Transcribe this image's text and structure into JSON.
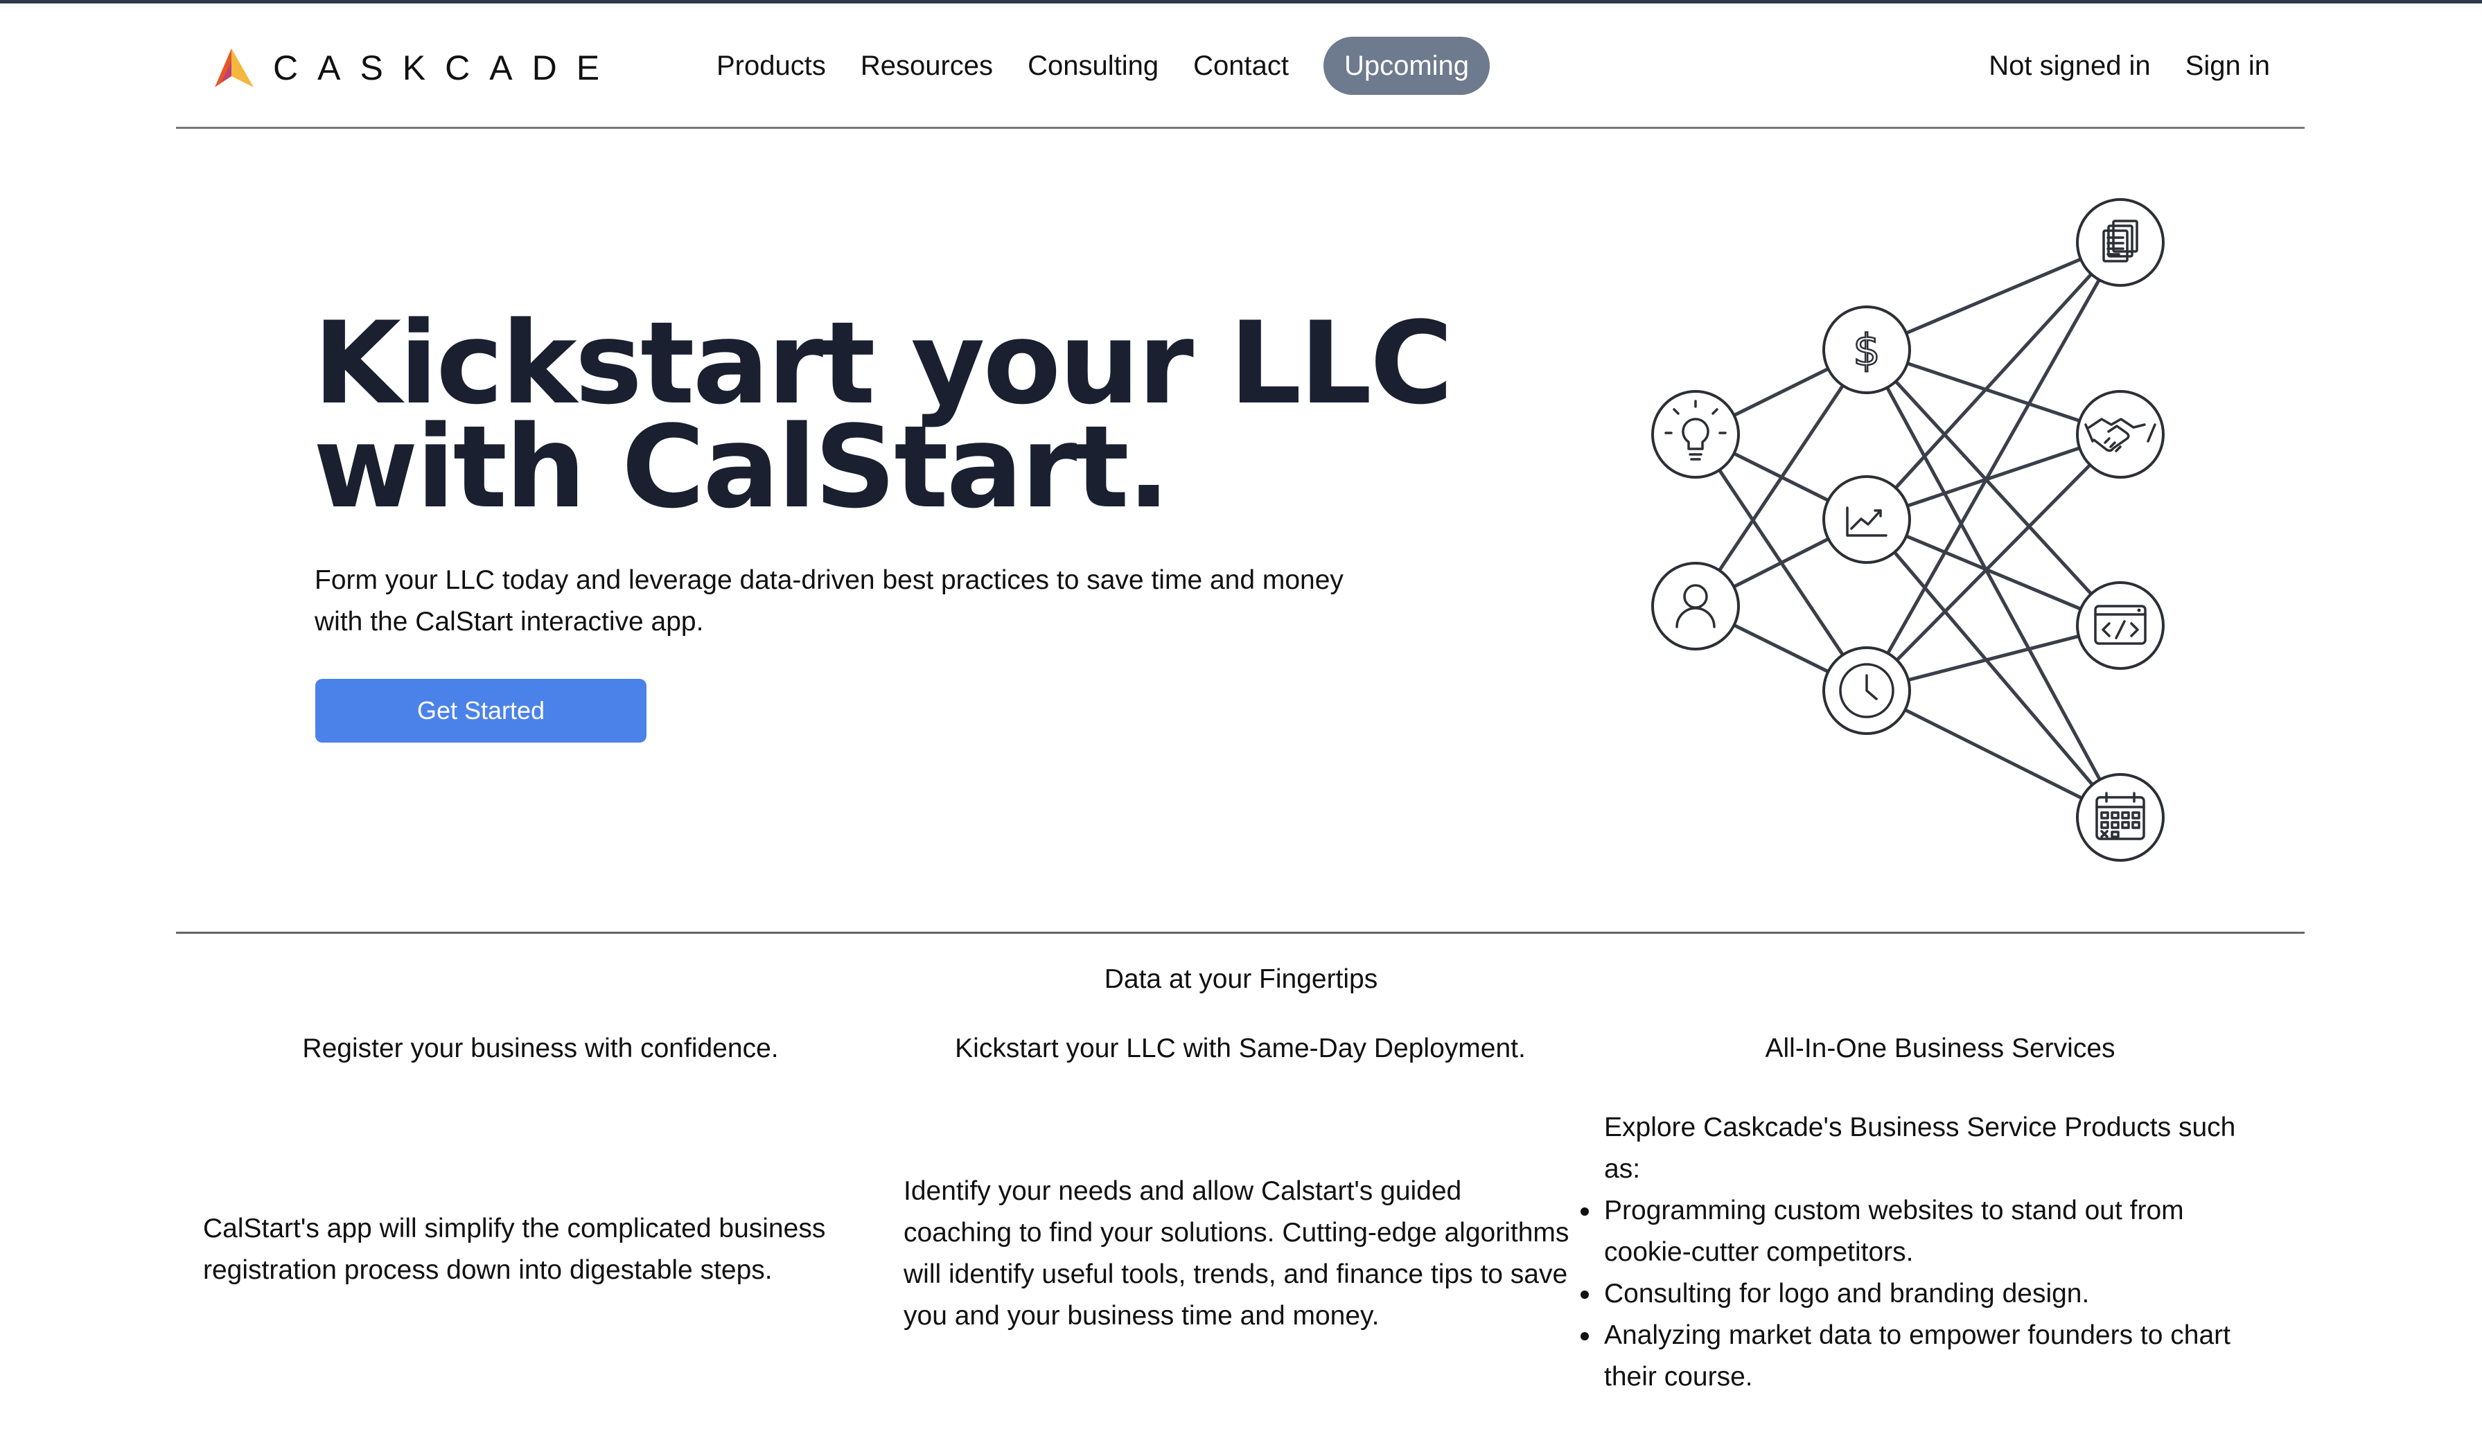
{
  "header": {
    "brand": "CASKCADE",
    "nav": [
      "Products",
      "Resources",
      "Consulting",
      "Contact"
    ],
    "nav_pill": "Upcoming",
    "status": "Not signed in",
    "signin": "Sign in"
  },
  "hero": {
    "title_line1": "Kickstart your LLC",
    "title_line2": "with CalStart.",
    "subtitle": "Form your LLC today and leverage data-driven best practices to save time and money with the CalStart interactive app.",
    "cta": "Get Started"
  },
  "features": {
    "section_title": "Data at your Fingertips",
    "col1": {
      "title": "Register your business with confidence.",
      "body": "CalStart's app will simplify the complicated business registration process down into digestable steps."
    },
    "col2": {
      "title": "Kickstart your LLC with Same-Day Deployment.",
      "body": "Identify your needs and allow Calstart's guided coaching to find your solutions. Cutting-edge algorithms will identify useful tools, trends, and finance tips to save you and your business time and money."
    },
    "col3": {
      "title": "All-In-One Business Services",
      "intro": "Explore Caskcade's Business Service Products such as:",
      "bullets": [
        "Programming custom websites to stand out from cookie-cutter competitors.",
        "Consulting for logo and branding design.",
        "Analyzing market data to empower founders to chart their course."
      ]
    }
  },
  "illustration_icons": [
    "lightbulb-icon",
    "user-icon",
    "dollar-icon",
    "chart-icon",
    "clock-icon",
    "documents-icon",
    "handshake-icon",
    "code-icon",
    "calendar-icon"
  ],
  "colors": {
    "accent": "#4b82ea",
    "pill": "#6e7a8e",
    "heading": "#1a2030"
  }
}
